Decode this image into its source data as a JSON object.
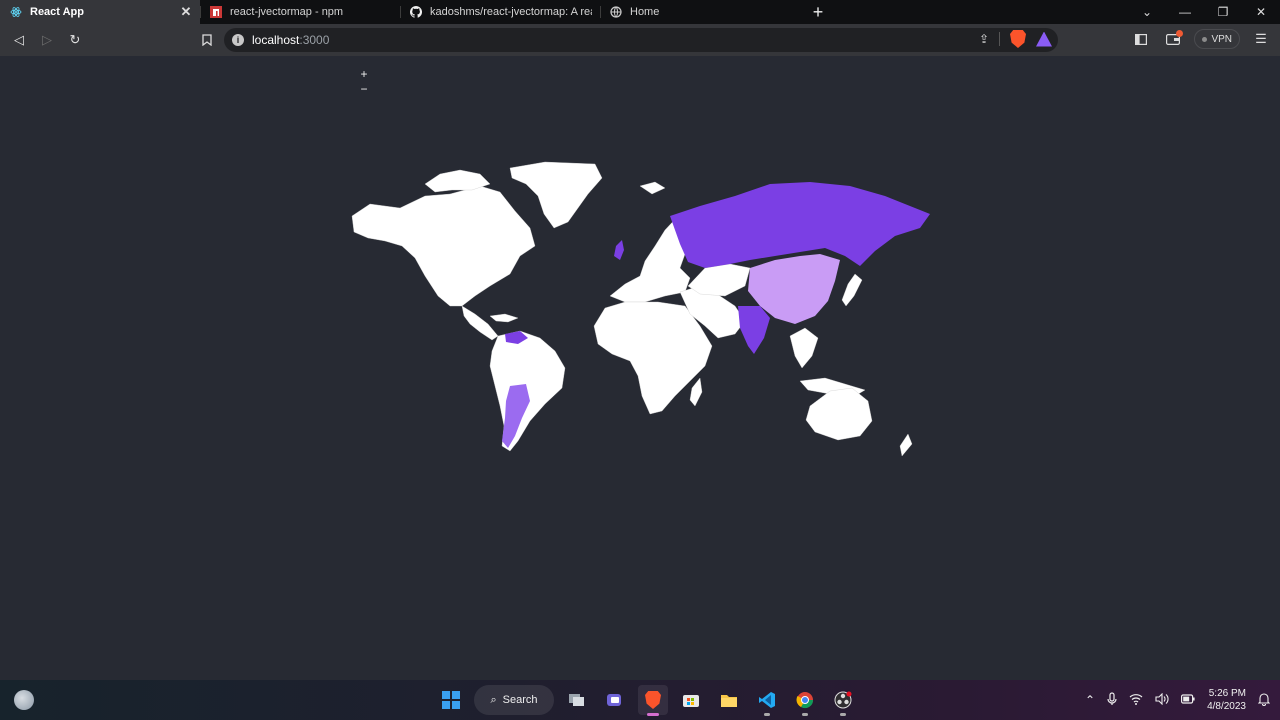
{
  "browser": {
    "tabs": [
      {
        "title": "React App",
        "active": true,
        "icon": "react-icon"
      },
      {
        "title": "react-jvectormap - npm",
        "active": false,
        "icon": "npm-icon"
      },
      {
        "title": "kadoshms/react-jvectormap: A react w",
        "active": false,
        "icon": "github-icon"
      },
      {
        "title": "Home",
        "active": false,
        "icon": "globe-icon"
      }
    ],
    "new_tab": "+",
    "url_host": "localhost",
    "url_port": ":3000",
    "vpn_label": "VPN"
  },
  "map": {
    "zoom_in": "+",
    "zoom_out": "−",
    "colors": {
      "background": "#272a33",
      "land": "#ffffff",
      "dark_purple": "#7b3fe4",
      "medium_purple": "#9b6bf0",
      "light_purple": "#c99cf5"
    },
    "highlighted_regions": [
      "Russia",
      "China",
      "India",
      "Argentina",
      "Venezuela",
      "United Kingdom"
    ]
  },
  "taskbar": {
    "search_label": "Search",
    "time": "5:26 PM",
    "date": "4/8/2023"
  }
}
